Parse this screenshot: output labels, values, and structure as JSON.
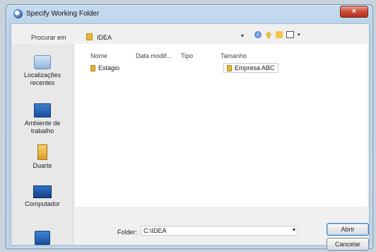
{
  "window": {
    "title": "Specify Working Folder",
    "close_glyph": "×"
  },
  "look_in": {
    "label": "Procurar em",
    "value": "IDEA",
    "dropdown_glyph": "▾"
  },
  "toolbar": [
    "back-icon",
    "up-folder-icon",
    "new-folder-icon",
    "view-menu-icon"
  ],
  "places": [
    {
      "label": "Localizações recentes",
      "icon": "recent-places-icon"
    },
    {
      "label": "Ambiente de trabalho",
      "icon": "desktop-icon"
    },
    {
      "label": "Duarte",
      "icon": "user-folder-icon"
    },
    {
      "label": "Computador",
      "icon": "computer-icon"
    },
    {
      "label": "",
      "icon": "network-icon"
    }
  ],
  "columns": [
    "Nome",
    "Data modif...",
    "Tipo",
    "Tamanho"
  ],
  "files": [
    {
      "name": "Estágio"
    },
    {
      "name": "Empresa ABC"
    }
  ],
  "folder": {
    "label": "Folder:",
    "value": "C:\\IDEA",
    "dropdown_glyph": "▾"
  },
  "buttons": {
    "open": "Abrir",
    "cancel": "Cancelar"
  }
}
